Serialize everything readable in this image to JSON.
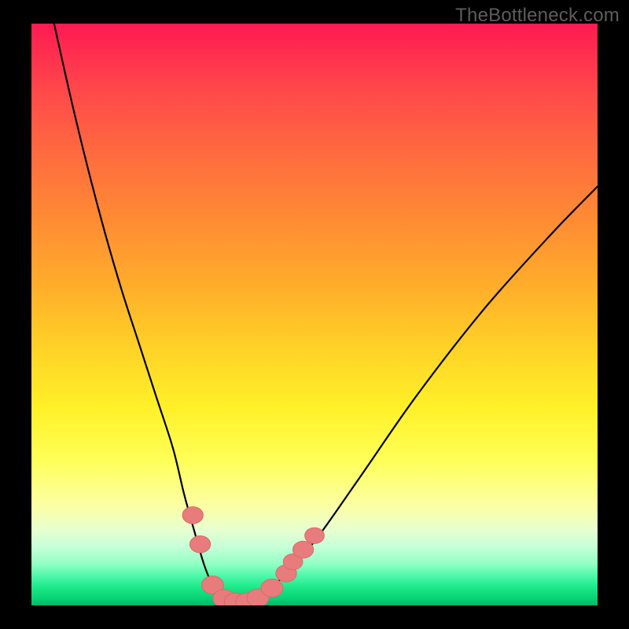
{
  "watermark": "TheBottleneck.com",
  "colors": {
    "marker_fill": "#e87c7c",
    "marker_stroke": "#d96a6a",
    "curve": "#000000"
  },
  "chart_data": {
    "type": "line",
    "title": "",
    "xlabel": "",
    "ylabel": "",
    "xlim": [
      0,
      100
    ],
    "ylim": [
      0,
      100
    ],
    "grid": false,
    "series": [
      {
        "name": "bottleneck-curve",
        "x": [
          4,
          7,
          10,
          13,
          16,
          19,
          22,
          25,
          27,
          29,
          30.5,
          32,
          34,
          36,
          38,
          40,
          44,
          50,
          58,
          68,
          80,
          92,
          100
        ],
        "values": [
          100,
          87,
          75,
          64,
          54,
          45,
          36,
          27,
          19,
          12,
          7,
          3.5,
          1.3,
          0.5,
          0.5,
          1.3,
          4.5,
          11,
          22,
          36,
          51,
          64,
          72
        ]
      }
    ],
    "markers": [
      {
        "x": 28.5,
        "y": 15.5,
        "r": 1.8
      },
      {
        "x": 29.8,
        "y": 10.5,
        "r": 1.8
      },
      {
        "x": 32.0,
        "y": 3.5,
        "r": 2.0
      },
      {
        "x": 34.0,
        "y": 1.2,
        "r": 2.0
      },
      {
        "x": 36.0,
        "y": 0.6,
        "r": 2.0
      },
      {
        "x": 38.0,
        "y": 0.6,
        "r": 2.0
      },
      {
        "x": 40.0,
        "y": 1.3,
        "r": 2.0
      },
      {
        "x": 42.5,
        "y": 3.0,
        "r": 2.0
      },
      {
        "x": 45.0,
        "y": 5.5,
        "r": 1.8
      },
      {
        "x": 46.2,
        "y": 7.5,
        "r": 1.6
      },
      {
        "x": 48.0,
        "y": 9.6,
        "r": 1.8
      },
      {
        "x": 50.0,
        "y": 12.0,
        "r": 1.6
      }
    ]
  }
}
